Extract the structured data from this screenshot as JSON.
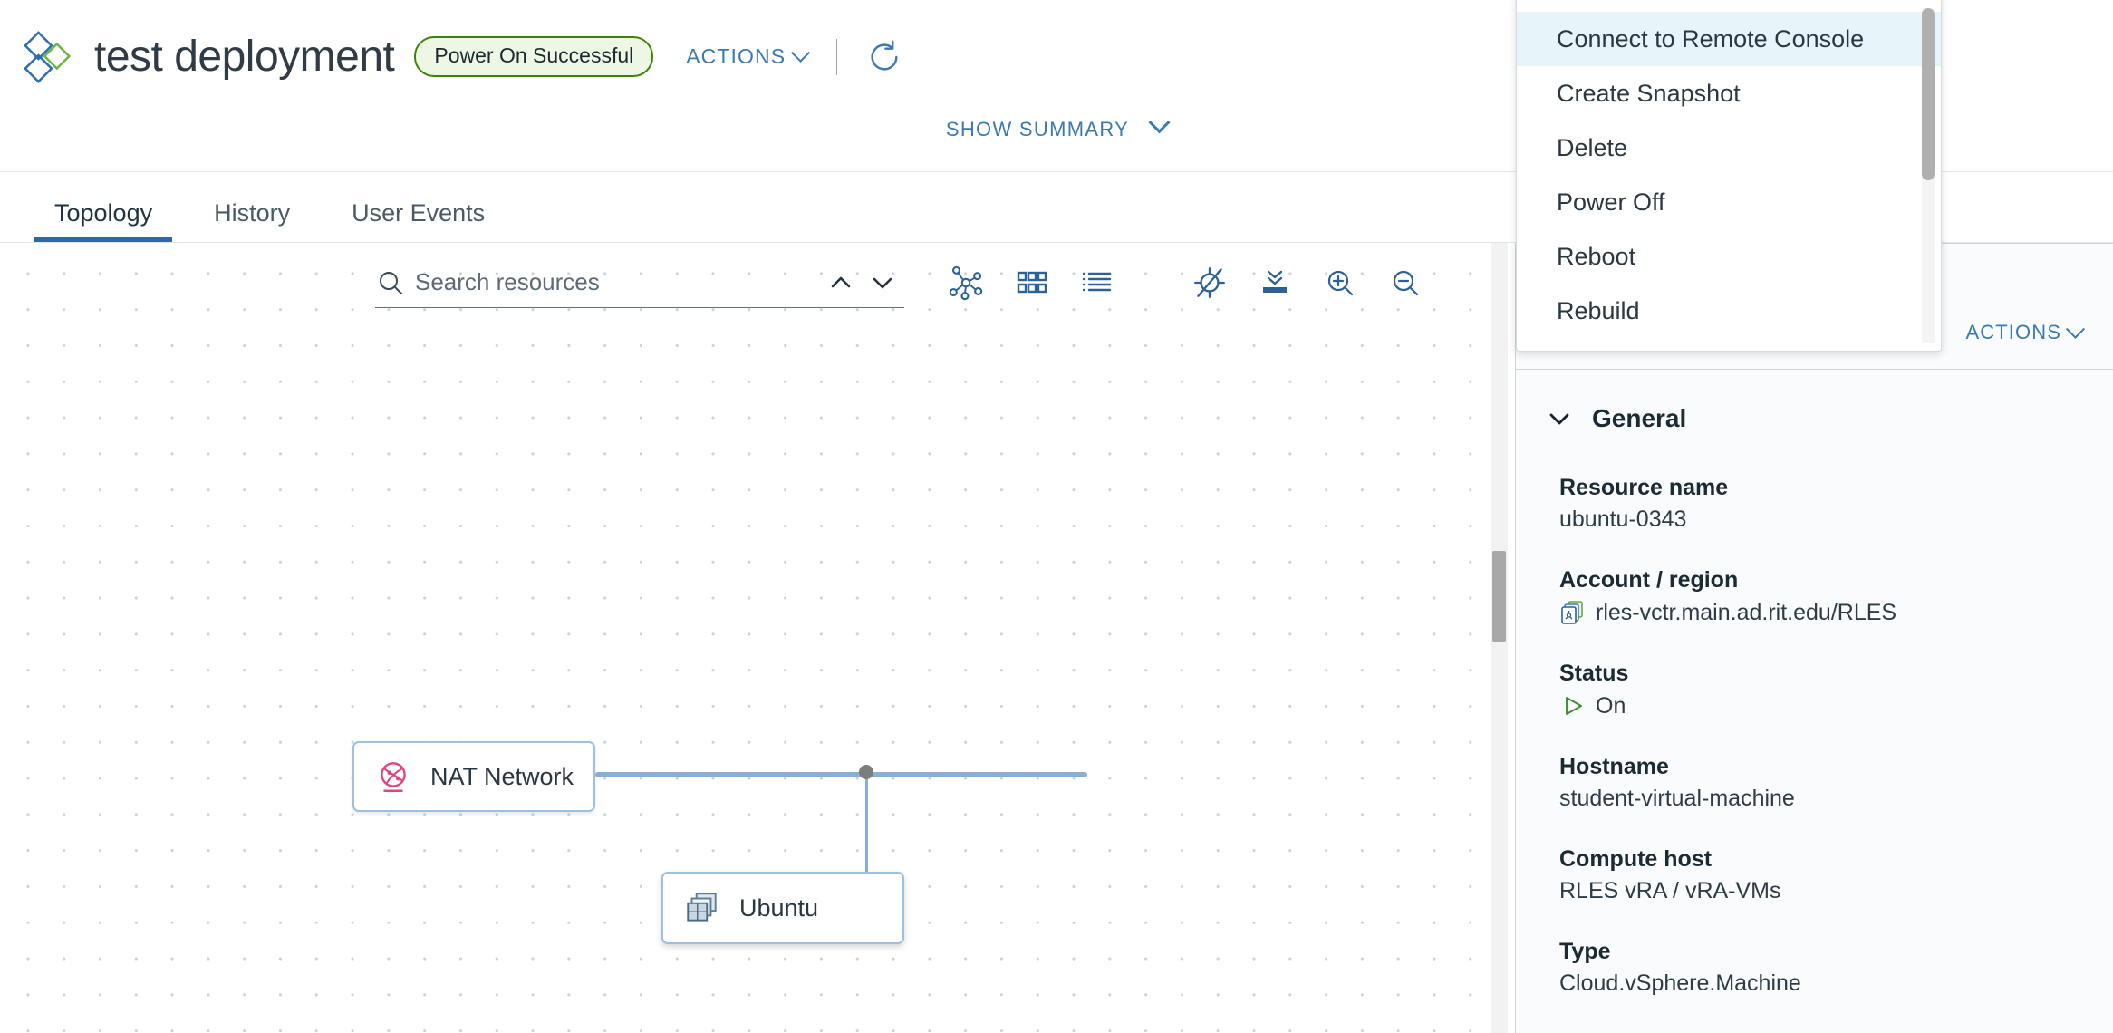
{
  "header": {
    "logo_icon": "vmware-aria-diamond-logo",
    "title": "test deployment",
    "status_badge": "Power On Successful",
    "status_border_color": "#41810b",
    "status_bg_color": "#eef7e3",
    "actions_label": "ACTIONS",
    "refresh_icon": "refresh-icon",
    "show_summary_label": "SHOW SUMMARY",
    "accent_color": "#3b7ab0"
  },
  "tabs": [
    {
      "label": "Topology",
      "active": true
    },
    {
      "label": "History",
      "active": false
    },
    {
      "label": "User Events",
      "active": false
    }
  ],
  "topology_toolbar": {
    "search_placeholder": "Search resources",
    "search_value": "",
    "search_icon": "search-icon",
    "nav_up_icon": "chevron-up-icon",
    "nav_down_icon": "chevron-down-icon",
    "buttons": [
      {
        "name": "graph-view-button",
        "icon": "network-graph-icon"
      },
      {
        "name": "card-view-button",
        "icon": "grid-cards-icon"
      },
      {
        "name": "list-view-button",
        "icon": "list-icon"
      },
      {
        "name": "hide-unrelated-button",
        "icon": "crosshair-slash-icon"
      },
      {
        "name": "fit-to-screen-button",
        "icon": "collapse-to-line-icon"
      },
      {
        "name": "zoom-in-button",
        "icon": "zoom-in-icon"
      },
      {
        "name": "zoom-out-button",
        "icon": "zoom-out-icon"
      },
      {
        "name": "expand-fullscreen-button",
        "icon": "expand-arrows-icon"
      }
    ]
  },
  "topology": {
    "nodes": [
      {
        "id": "nat-network",
        "label": "NAT Network",
        "icon": "network-globe-icon",
        "icon_color": "#e0437f",
        "selected": false
      },
      {
        "id": "ubuntu",
        "label": "Ubuntu",
        "icon": "virtual-machine-icon",
        "icon_color": "#5b7e96",
        "selected": true
      }
    ],
    "edge_color": "#88b0d6",
    "connector_dot_color": "#7d7d7d"
  },
  "dropdown_menu": {
    "items": [
      {
        "label": "Connect to Remote Console",
        "highlighted": true
      },
      {
        "label": "Create Snapshot",
        "highlighted": false
      },
      {
        "label": "Delete",
        "highlighted": false
      },
      {
        "label": "Power Off",
        "highlighted": false
      },
      {
        "label": "Reboot",
        "highlighted": false
      },
      {
        "label": "Rebuild",
        "highlighted": false
      }
    ],
    "highlight_color": "#e7f5fb"
  },
  "detail_panel": {
    "actions_label": "ACTIONS",
    "section_title": "General",
    "caret_icon": "chevron-down-icon",
    "fields": [
      {
        "label": "Resource name",
        "value": "ubuntu-0343",
        "icon": null
      },
      {
        "label": "Account / region",
        "value": "rles-vctr.main.ad.rit.edu/RLES",
        "icon": "cloud-account-icon"
      },
      {
        "label": "Status",
        "value": "On",
        "icon": "power-on-triangle-icon"
      },
      {
        "label": "Hostname",
        "value": "student-virtual-machine",
        "icon": null
      },
      {
        "label": "Compute host",
        "value": "RLES vRA / vRA-VMs",
        "icon": null
      },
      {
        "label": "Type",
        "value": "Cloud.vSphere.Machine",
        "icon": null
      }
    ]
  }
}
